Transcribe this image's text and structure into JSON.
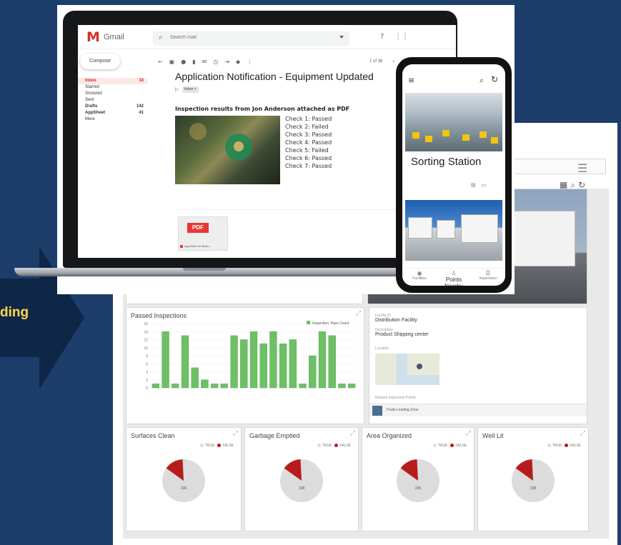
{
  "arrow": {
    "text": "ding",
    "color": "#ffd84a"
  },
  "dashboard": {
    "menu_icon": "menu-icon",
    "tools": [
      "grid-icon",
      "search-icon",
      "refresh-icon"
    ],
    "inspections_panel": {
      "title": "Passed Inspections",
      "legend": "Inspection: Pass Count"
    },
    "detail_panel": {
      "facility_label": "Facility ID",
      "facility_value": "Distribution Facility",
      "description_label": "Description",
      "description_value": "Product Shipping center",
      "location_label": "Location",
      "related_label": "Related Inspection Points",
      "related_item": "Fruits Loading Zone"
    },
    "pies": [
      {
        "title": "Surfaces Clean",
        "true_label": "TRUE",
        "false_label": "FALSE",
        "center": "236"
      },
      {
        "title": "Garbage Emptied",
        "true_label": "TRUE",
        "false_label": "FALSE",
        "center": "238"
      },
      {
        "title": "Area Organized",
        "true_label": "TRUE",
        "false_label": "FALSE",
        "center": "236"
      },
      {
        "title": "Well Lit",
        "true_label": "TRUE",
        "false_label": "FALSE",
        "center": "238"
      }
    ],
    "colors": {
      "bar": "#6dc066",
      "bar_stroke": "#4a9e44",
      "pie_true": "#dcdcdc",
      "pie_false": "#b71c1c"
    }
  },
  "gmail": {
    "logo": "Gmail",
    "search_placeholder": "Search mail",
    "compose": "Compose",
    "nav": [
      {
        "label": "Inbox",
        "count": "34"
      },
      {
        "label": "Starred",
        "count": ""
      },
      {
        "label": "Snoozed",
        "count": ""
      },
      {
        "label": "Sent",
        "count": ""
      },
      {
        "label": "Drafts",
        "count": "142"
      },
      {
        "label": "AppSheet",
        "count": "41"
      },
      {
        "label": "More",
        "count": ""
      }
    ],
    "page_indicator": "1 of 36",
    "subject": "Application Notification - Equipment Updated",
    "label_chip": "Inbox ×",
    "body_intro": "Inspection results from Jon Anderson attached as PDF",
    "checks": [
      "Check 1: Passed",
      "Check 2: Failed",
      "Check 3: Passed",
      "Check 4: Passed",
      "Check 5: Failed",
      "Check 6: Passed",
      "Check 7: Passed"
    ],
    "attachment": {
      "badge": "PDF",
      "name": "AppSheet for Busin..."
    },
    "accent": "#d93025"
  },
  "phone": {
    "title": "Sorting Station",
    "nav": [
      {
        "label": "Facilities",
        "icon": "location-icon"
      },
      {
        "label": "Points Nearby",
        "icon": "person-pin-icon"
      },
      {
        "label": "Inspections",
        "icon": "list-icon"
      }
    ]
  },
  "chart_data": {
    "type": "bar",
    "title": "Passed Inspections",
    "series": [
      {
        "name": "Inspection: Pass Count",
        "values": [
          1,
          14,
          1,
          13,
          5,
          2,
          1,
          1,
          13,
          12,
          14,
          11,
          14,
          11,
          12,
          1,
          8,
          14,
          13,
          1,
          1
        ]
      }
    ],
    "ylim": [
      0,
      16
    ],
    "yticks": [
      0,
      2,
      4,
      6,
      8,
      10,
      12,
      14,
      16
    ]
  }
}
